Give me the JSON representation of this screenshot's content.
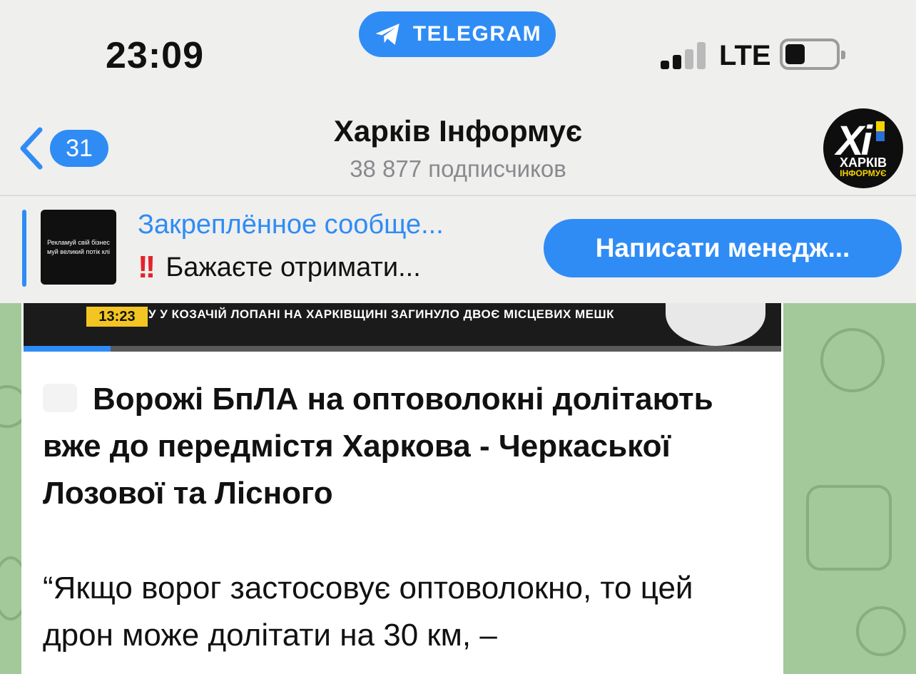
{
  "status_bar": {
    "time": "23:09",
    "app_pill": "TELEGRAM",
    "network": "LTE",
    "signal_bars": 2
  },
  "header": {
    "back_count": "31",
    "title": "Харків Інформує",
    "subscribers": "38 877 подписчиков",
    "avatar": {
      "letters": "Xi",
      "name": "ХАРКІВ",
      "sub": "ІНФОРМУЄ"
    }
  },
  "pinned": {
    "title": "Закреплённое сообще...",
    "icon": "double-exclamation-icon",
    "text": "Бажаєте отримати...",
    "thumb_text": "Рекламуй свій бізнес\nмуй великий потік клі",
    "action_button": "Написати менедж..."
  },
  "message": {
    "video": {
      "time": "13:23",
      "ticker": "У У КОЗАЧІЙ ЛОПАНІ НА ХАРКІВЩИНІ ЗАГИНУЛО ДВОЄ МІСЦЕВИХ МЕШК",
      "progress": 0.115
    },
    "headline": "Ворожі БпЛА на оптоволокні долітають вже до передмістя Харкова - Черкаської Лозової та Лісного",
    "body": "“Якщо ворог застосовує оптоволокно, то цей дрон може долітати на 30 км, –"
  },
  "colors": {
    "accent": "#2f8cf5",
    "header_bg": "#efefee",
    "wallpaper": "#a3c89a",
    "ticker_time_bg": "#f3c522"
  }
}
